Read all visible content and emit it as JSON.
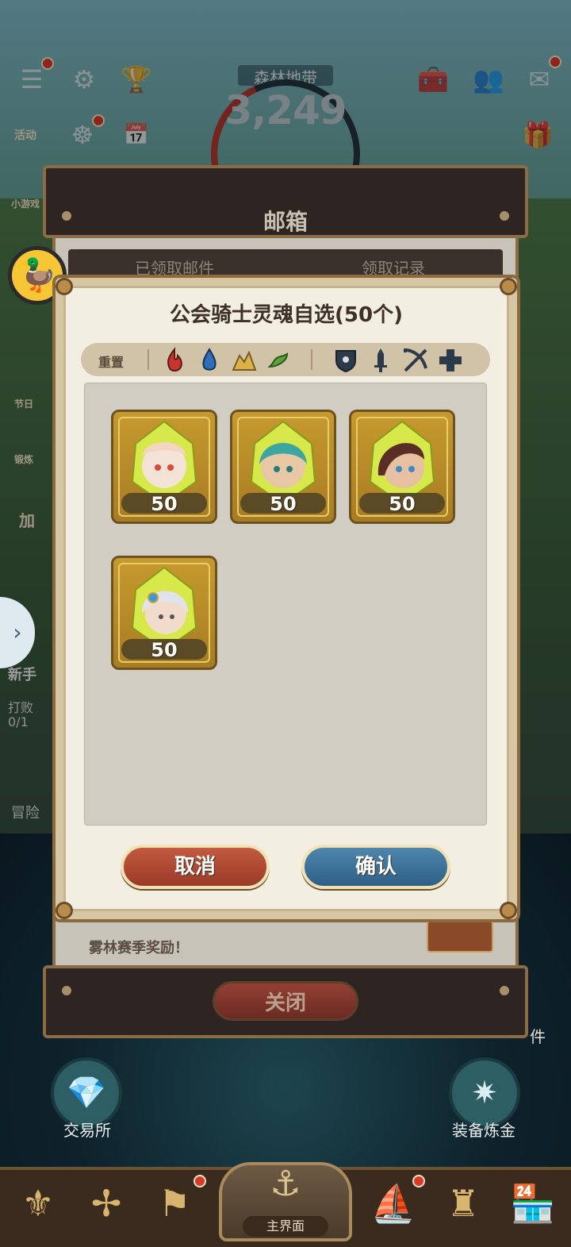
{
  "hud": {
    "zone_name": "森林地带",
    "power": "3,249",
    "side_left": [
      "活动",
      "小游戏",
      "节日",
      "锻炼",
      "加"
    ],
    "quest_hint": "新手",
    "quest_text": "打败",
    "quest_progress": "0/1",
    "adventure_label": "冒险"
  },
  "mailbox": {
    "title": "邮箱",
    "tabs": [
      "已领取邮件",
      "领取记录"
    ],
    "mail_item_text": "雾林赛季奖励！",
    "close_label": "关闭"
  },
  "dialog": {
    "title": "公会骑士灵魂自选(50个)",
    "reset_label": "重置",
    "filter_elements": [
      "fire-element-icon",
      "water-element-icon",
      "earth-element-icon",
      "wind-element-icon"
    ],
    "filter_classes": [
      "tank-shield-icon",
      "warrior-sword-icon",
      "ranged-bow-icon",
      "healer-cross-icon"
    ],
    "cards": [
      {
        "name": "knight-soul-card-1",
        "count": "50",
        "hair": "#f2d6c2",
        "accent": "#d84a3a"
      },
      {
        "name": "knight-soul-card-2",
        "count": "50",
        "hair": "#3ea6a0",
        "accent": "#2a7c7a"
      },
      {
        "name": "knight-soul-card-3",
        "count": "50",
        "hair": "#5a2e24",
        "accent": "#3a8ac8"
      },
      {
        "name": "knight-soul-card-4",
        "count": "50",
        "hair": "#e2e2ea",
        "accent": "#3a9ad8"
      }
    ],
    "cancel_label": "取消",
    "confirm_label": "确认"
  },
  "bottom": {
    "left_circle_label": "交易所",
    "right_circle_label": "装备炼金",
    "right_edge_text": "件",
    "home_label": "主界面"
  },
  "colors": {
    "cancel": "#a8402c",
    "confirm": "#3a6d95",
    "card_gold": "#c69a2e"
  }
}
